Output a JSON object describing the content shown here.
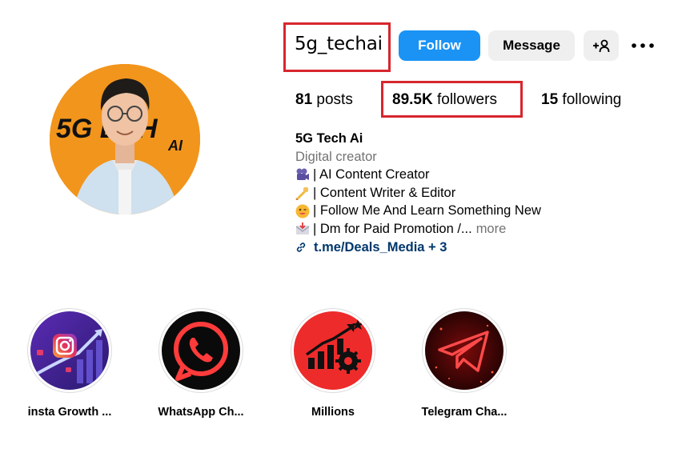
{
  "profile": {
    "username": "5g_techai",
    "buttons": {
      "follow": "Follow",
      "message": "Message"
    },
    "avatar_text": {
      "line1": "5G ECH",
      "line2": "AI"
    },
    "stats": {
      "posts_count": "81",
      "posts_label": "posts",
      "followers_count": "89.5K",
      "followers_label": "followers",
      "following_count": "15",
      "following_label": "following"
    },
    "bio": {
      "name": "5G Tech Ai",
      "category": "Digital creator",
      "lines": [
        {
          "icon": "video-camera-emoji",
          "text": "| AI Content Creator"
        },
        {
          "icon": "writing-hand-emoji",
          "text": "| Content Writer & Editor"
        },
        {
          "icon": "winking-face-emoji",
          "text": "| Follow Me And Learn Something New"
        },
        {
          "icon": "envelope-emoji",
          "text": "| Dm for Paid Promotion /..."
        }
      ],
      "more": "more",
      "link": "t.me/Deals_Media + 3"
    }
  },
  "highlights": [
    {
      "label": "insta Growth ...",
      "icon": "instagram-growth-icon"
    },
    {
      "label": "WhatsApp Ch...",
      "icon": "whatsapp-icon"
    },
    {
      "label": "Millions",
      "icon": "growth-chart-gear-icon"
    },
    {
      "label": "Telegram Cha...",
      "icon": "telegram-icon"
    }
  ],
  "colors": {
    "follow_blue": "#1a93f5",
    "highlight_box_red": "#d7262e",
    "link_blue": "#00376b",
    "muted_gray": "#737373",
    "button_gray": "#efefef",
    "avatar_orange": "#f2951c"
  }
}
